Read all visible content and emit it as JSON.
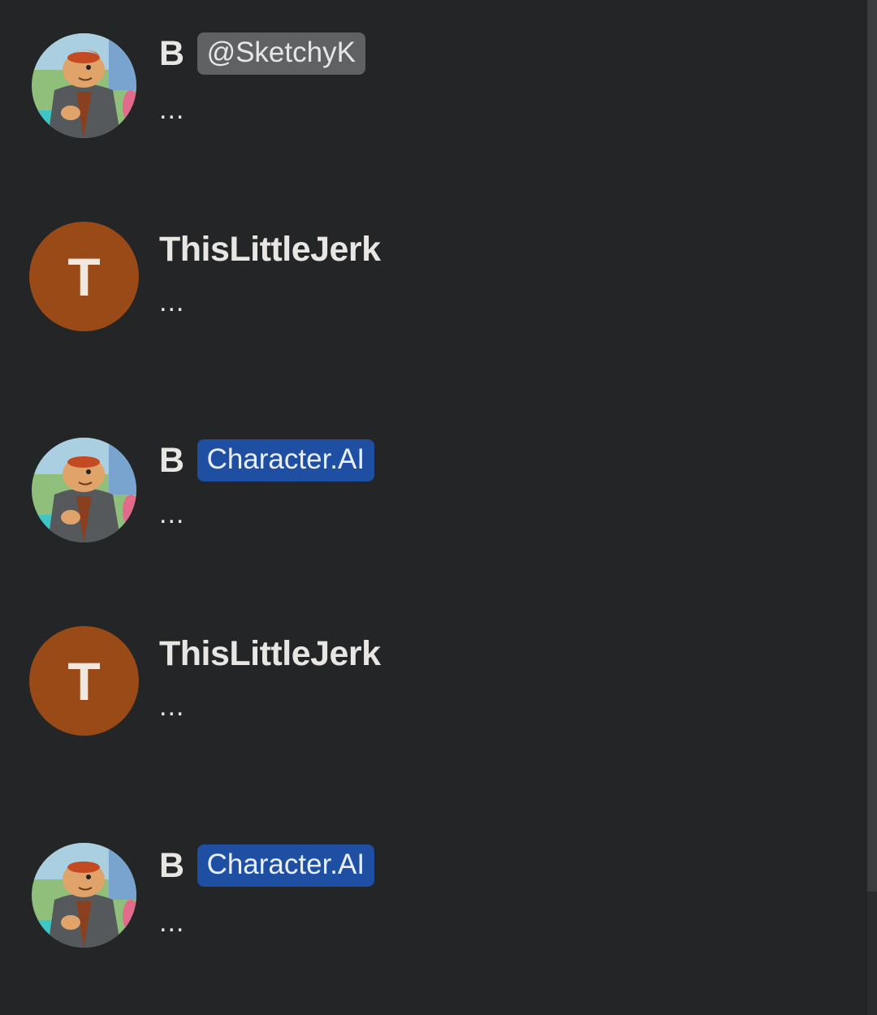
{
  "messages": [
    {
      "author": "B",
      "badge": "@SketchyK",
      "badge_type": "handle",
      "avatar": "cartoon-character-icon",
      "text": "..."
    },
    {
      "author": "ThisLittleJerk",
      "avatar_letter": "T",
      "avatar_color": "#9a4a17",
      "text": "..."
    },
    {
      "author": "B",
      "badge": "Character.AI",
      "badge_type": "ai",
      "avatar": "cartoon-character-icon",
      "text": "..."
    },
    {
      "author": "ThisLittleJerk",
      "avatar_letter": "T",
      "avatar_color": "#9a4a17",
      "text": "..."
    },
    {
      "author": "B",
      "badge": "Character.AI",
      "badge_type": "ai",
      "avatar": "cartoon-character-icon",
      "text": "..."
    }
  ],
  "colors": {
    "background": "#242526",
    "handle_badge": "#5f6163",
    "ai_badge": "#1f4fa3",
    "user_avatar": "#9a4a17"
  }
}
